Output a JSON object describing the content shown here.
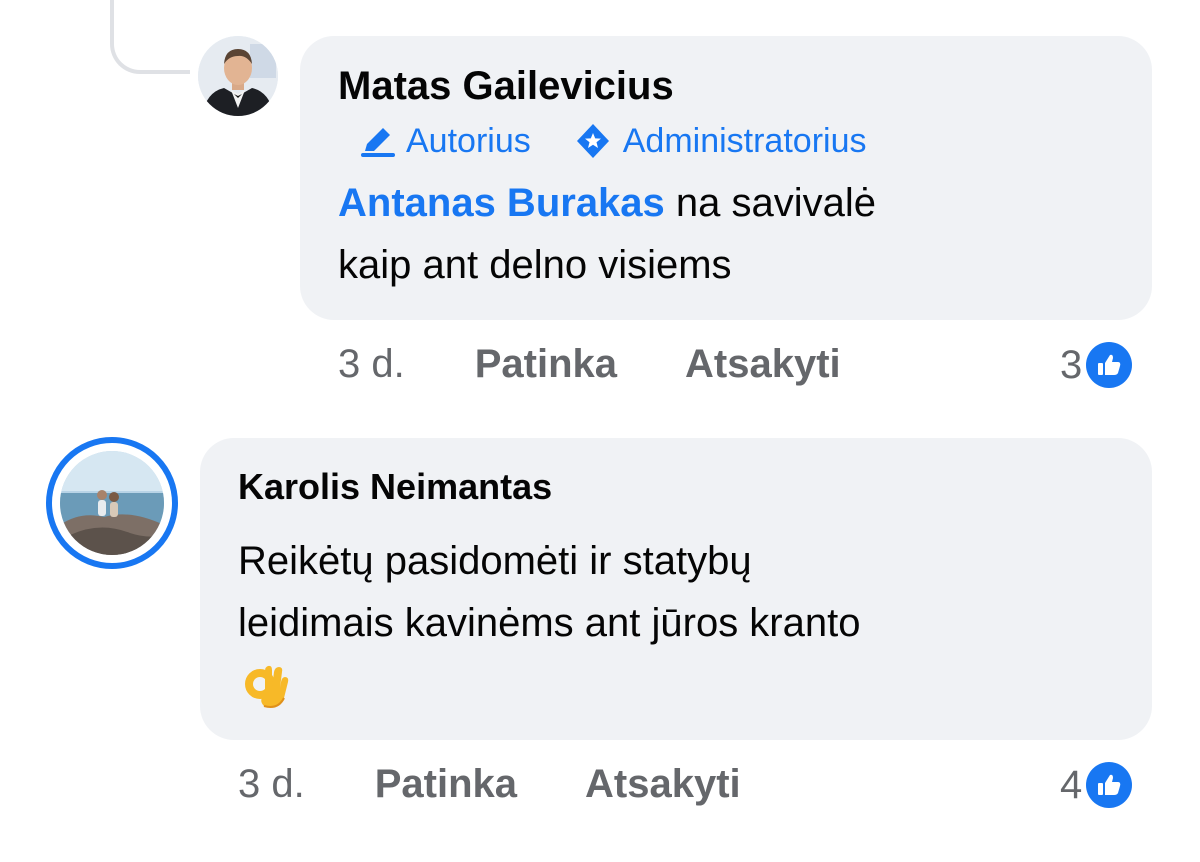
{
  "comments": [
    {
      "author": "Matas Gailevicius",
      "badges": [
        {
          "label": "Autorius",
          "icon": "pencil-icon"
        },
        {
          "label": "Administratorius",
          "icon": "admin-shield-icon"
        }
      ],
      "mention": "Antanas Burakas",
      "text_line1": " na savivalė",
      "text_line2": "kaip ant delno visiems",
      "time": "3 d.",
      "like_label": "Patinka",
      "reply_label": "Atsakyti",
      "reaction_count": "3",
      "reaction_icon": "thumbs-up-icon"
    },
    {
      "author": "Karolis Neimantas",
      "text_line1": "Reikėtų pasidomėti ir statybų",
      "text_line2": "leidimais kavinėms ant jūros kranto",
      "emoji": "ok-hand-emoji",
      "time": "3 d.",
      "like_label": "Patinka",
      "reply_label": "Atsakyti",
      "reaction_count": "4",
      "reaction_icon": "thumbs-up-icon"
    }
  ],
  "colors": {
    "accent": "#1877f2",
    "bubble": "#f0f2f5",
    "meta_text": "#65676b",
    "thread_line": "#dfe1e5"
  }
}
